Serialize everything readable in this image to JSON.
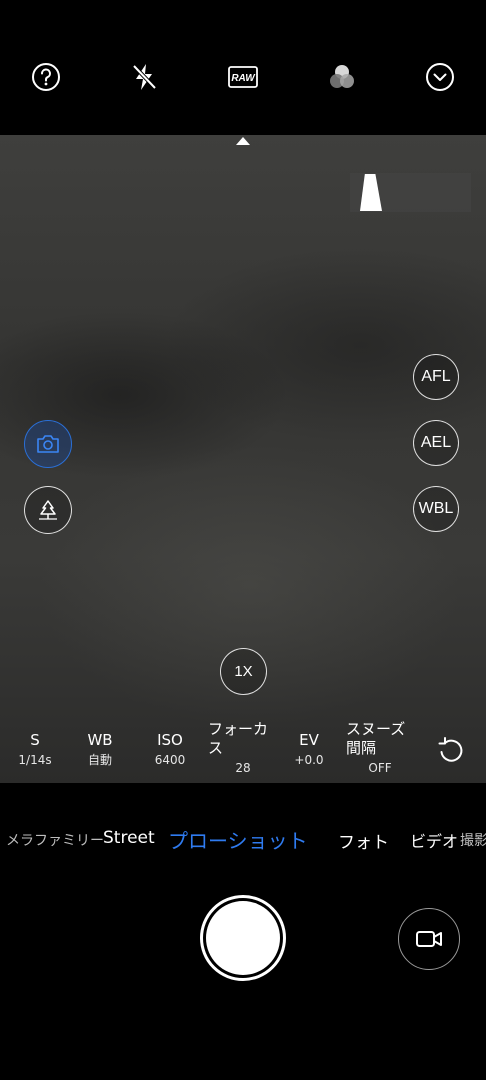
{
  "top_bar": {
    "icons": [
      "help-icon",
      "flash-off-icon",
      "raw-icon",
      "color-filter-icon",
      "expand-down-icon"
    ],
    "raw_label": "RAW"
  },
  "viewfinder": {
    "right_buttons": {
      "afl": "AFL",
      "ael": "AEL",
      "wbl": "WBL"
    },
    "left_buttons": [
      "camera-icon",
      "scene-icon"
    ],
    "zoom": "1X"
  },
  "params": {
    "shutter": {
      "label": "S",
      "value": "1/14s"
    },
    "wb": {
      "label": "WB",
      "value": "自動"
    },
    "iso": {
      "label": "ISO",
      "value": "6400"
    },
    "focus": {
      "label": "フォーカス",
      "value": "28"
    },
    "ev": {
      "label": "EV",
      "value": "+0.0"
    },
    "snooze": {
      "label": "スヌーズ間隔",
      "value": "OFF"
    }
  },
  "modes": {
    "items": [
      "メラファミリー",
      "Street",
      "プローショット",
      "フォト",
      "ビデオ",
      "撮影"
    ],
    "active": "プローショット"
  },
  "colors": {
    "accent": "#2f7bf0",
    "background": "#000000"
  }
}
